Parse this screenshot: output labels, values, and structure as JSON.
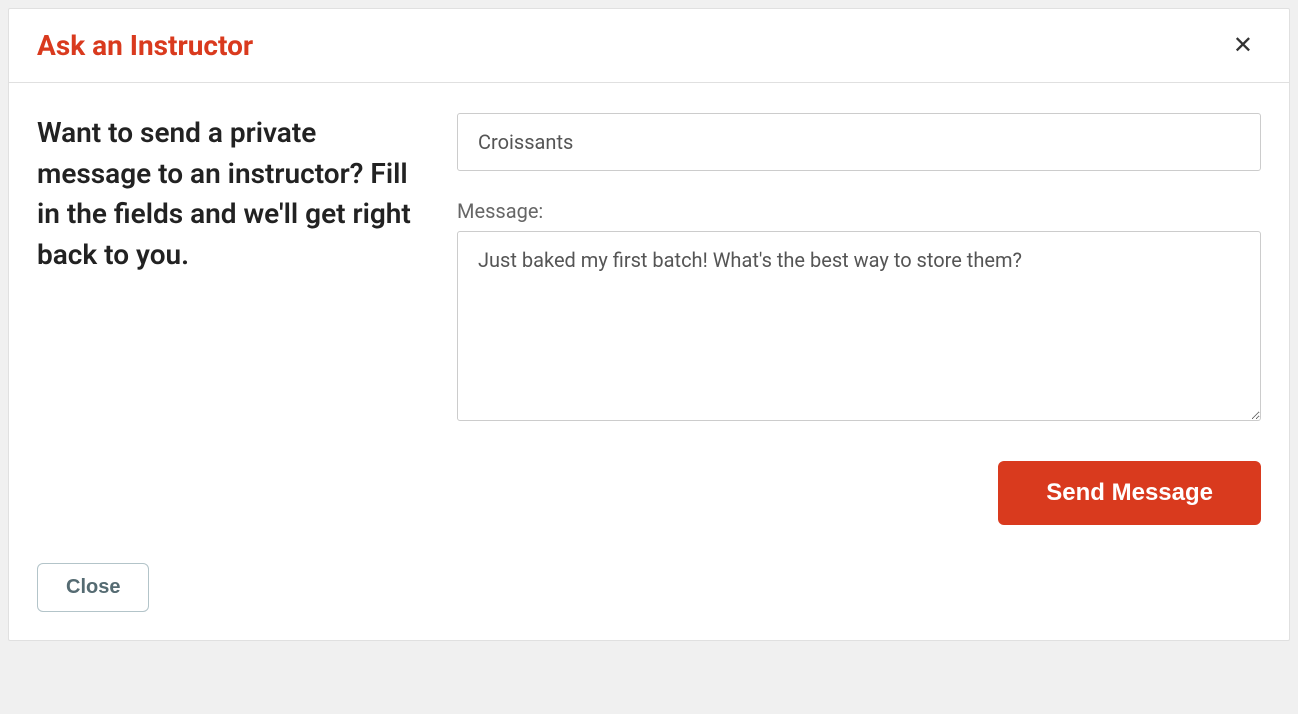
{
  "modal": {
    "title": "Ask an Instructor",
    "close_x": "✕",
    "intro_text": "Want to send a private message to an instructor? Fill in the fields and we'll get right back to you.",
    "form": {
      "subject_value": "Croissants",
      "message_label": "Message:",
      "message_value": "Just baked my first batch! What's the best way to store them?",
      "send_button_label": "Send Message"
    },
    "footer": {
      "close_button_label": "Close"
    }
  }
}
